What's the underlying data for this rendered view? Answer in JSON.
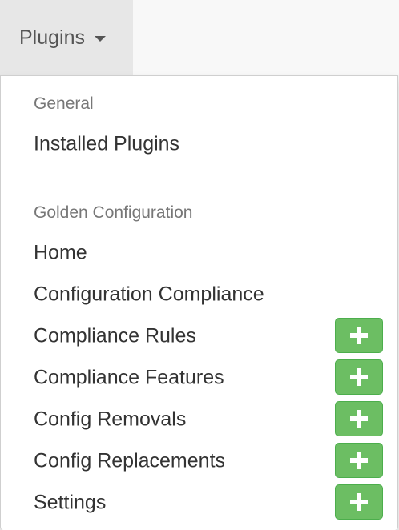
{
  "nav": {
    "menu_label": "Plugins"
  },
  "dropdown": {
    "sections": [
      {
        "header": "General",
        "items": [
          {
            "label": "Installed Plugins",
            "has_add_button": false
          }
        ]
      },
      {
        "header": "Golden Configuration",
        "items": [
          {
            "label": "Home",
            "has_add_button": false
          },
          {
            "label": "Configuration Compliance",
            "has_add_button": false
          },
          {
            "label": "Compliance Rules",
            "has_add_button": true
          },
          {
            "label": "Compliance Features",
            "has_add_button": true
          },
          {
            "label": "Config Removals",
            "has_add_button": true
          },
          {
            "label": "Config Replacements",
            "has_add_button": true
          },
          {
            "label": "Settings",
            "has_add_button": true
          }
        ]
      }
    ]
  },
  "icons": {
    "caret": "caret-down-icon",
    "add": "plus-icon"
  },
  "colors": {
    "add_button": "#6cbe63",
    "nav_active_bg": "#e7e7e7",
    "header_text": "#777777",
    "item_text": "#333333"
  }
}
